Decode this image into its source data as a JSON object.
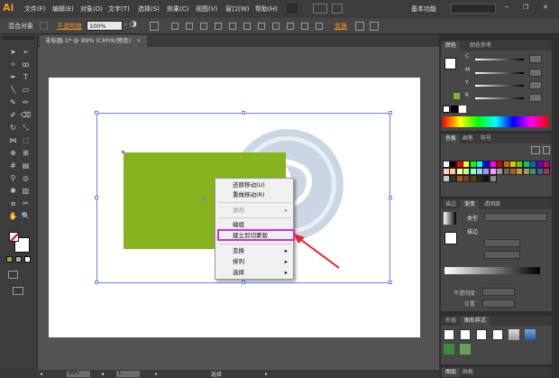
{
  "app": {
    "logo": "Ai",
    "workspace": "基本功能"
  },
  "menu": [
    "文件(F)",
    "编辑(E)",
    "对象(O)",
    "文字(T)",
    "选择(S)",
    "效果(C)",
    "视图(V)",
    "窗口(W)",
    "帮助(H)"
  ],
  "control_bar": {
    "mixed_objects": "混合对象",
    "opacity_label": "不透明度",
    "opacity_value": "100%",
    "transform": "变换"
  },
  "document": {
    "tab_title": "未标题-1* @ 89% (CMYK/预览)"
  },
  "context_menu": {
    "items": [
      {
        "label": "还原移动(U)",
        "disabled": false,
        "has_submenu": false
      },
      {
        "label": "重做移动(R)",
        "disabled": false,
        "has_submenu": false
      },
      {
        "label": "透视",
        "disabled": true,
        "has_submenu": true
      },
      {
        "label": "编组",
        "disabled": false,
        "has_submenu": false
      },
      {
        "label": "建立剪切蒙版",
        "disabled": false,
        "has_submenu": false,
        "highlighted": true
      },
      {
        "label": "变换",
        "disabled": false,
        "has_submenu": true
      },
      {
        "label": "排列",
        "disabled": false,
        "has_submenu": true
      },
      {
        "label": "选择",
        "disabled": false,
        "has_submenu": true
      }
    ]
  },
  "status": {
    "zoom": "89%",
    "page": "1",
    "tool": "选择"
  },
  "panels": {
    "color": {
      "tabs": [
        "颜色",
        "颜色参考"
      ],
      "channels": [
        "C",
        "M",
        "Y",
        "K"
      ]
    },
    "swatches": {
      "tabs": [
        "色板",
        "画笔",
        "符号"
      ]
    },
    "gradient": {
      "tabs": [
        "描边",
        "渐变",
        "透明度"
      ],
      "type_label": "类型",
      "stroke_label": "描边",
      "opacity_label": "不透明度",
      "position_label": "位置"
    },
    "appearance": {
      "tabs": [
        "外观",
        "图形样式"
      ]
    },
    "layers": {
      "tabs": [
        "图层",
        "画板"
      ]
    }
  },
  "colors": {
    "accent_green": "#86b31e",
    "highlight_magenta": "#d12ee8",
    "selection_blue": "#6a7ff0",
    "logo_orange": "#f7941d"
  }
}
